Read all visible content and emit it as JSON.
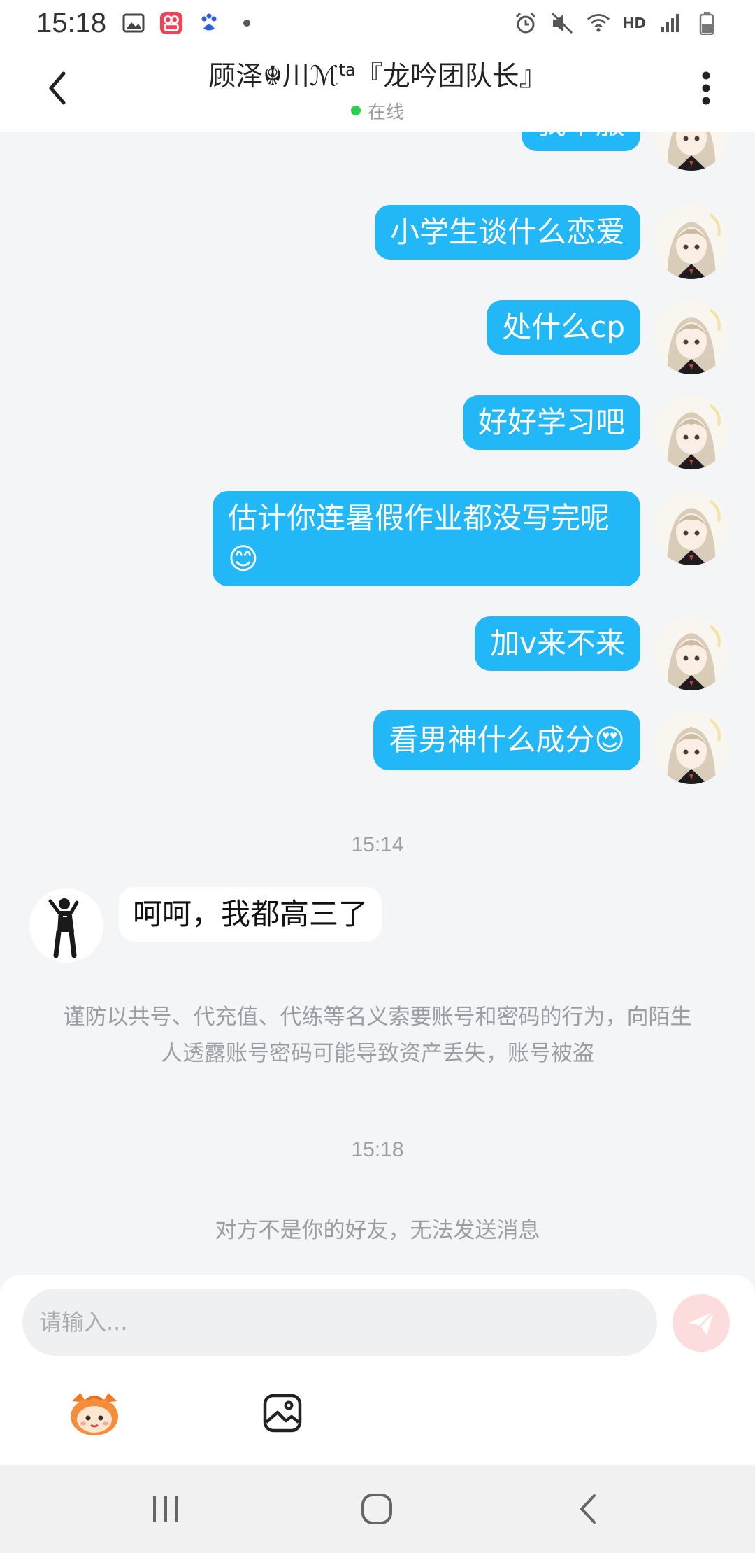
{
  "status_bar": {
    "time": "15:18",
    "left_icons": [
      "gallery-icon",
      "app-icon",
      "baidu-paw-icon",
      "dot-icon"
    ],
    "right_icons": [
      "alarm-icon",
      "mute-icon",
      "wifi-icon",
      "hd-icon",
      "signal-icon",
      "battery-icon"
    ],
    "hd_label": "HD"
  },
  "header": {
    "title": "顾泽☬川ℳ",
    "title_sup": "ta",
    "title_tail": "『龙吟团队长』",
    "status": "在线",
    "status_color": "#2fcc52"
  },
  "messages": [
    {
      "side": "right",
      "text": "我不服"
    },
    {
      "side": "right",
      "text": "小学生谈什么恋爱"
    },
    {
      "side": "right",
      "text": "处什么cp"
    },
    {
      "side": "right",
      "text": "好好学习吧"
    },
    {
      "side": "right",
      "text": "估计你连暑假作业都没写完呢",
      "emoji": "😊"
    },
    {
      "side": "right",
      "text": "加v来不来"
    },
    {
      "side": "right",
      "text": "看男神什么成分",
      "emoji": "😍"
    },
    {
      "side": "left",
      "text": "呵呵，我都高三了"
    }
  ],
  "timestamps": [
    "15:14",
    "15:18"
  ],
  "notices": {
    "security": "谨防以共号、代充值、代练等名义索要账号和密码的行为，向陌生人透露账号密码可能导致资产丢失，账号被盗",
    "not_friend": "对方不是你的好友，无法发送消息"
  },
  "composer": {
    "placeholder": "请输入..."
  },
  "colors": {
    "my_bubble": "#22b7f6",
    "background": "#f4f5f7",
    "send_button": "#fcdcdc"
  }
}
